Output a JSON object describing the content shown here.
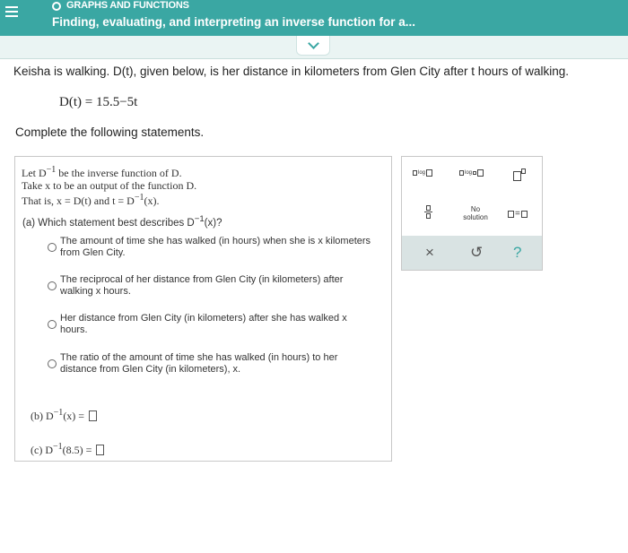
{
  "header": {
    "section_title": "GRAPHS AND FUNCTIONS",
    "problem_title": "Finding, evaluating, and interpreting an inverse function for a..."
  },
  "intro": "Keisha is walking. D(t), given below, is her distance in kilometers from Glen City after t hours of walking.",
  "formula": "D(t) = 15.5−5t",
  "instruction": "Complete the following statements.",
  "definition": {
    "line1_pre": "Let D",
    "line1_sup": "−1",
    "line1_post": " be the inverse function of D.",
    "line2": "Take x to be an output of the function D.",
    "line3_pre": "That is, x = D(t) and t = D",
    "line3_sup": "−1",
    "line3_post": "(x)."
  },
  "part_a": {
    "prompt_pre": "(a)  Which statement best describes D",
    "prompt_sup": "−1",
    "prompt_post": "(x)?",
    "options": [
      "The amount of time she has walked (in hours) when she is x kilometers from Glen City.",
      "The reciprocal of her distance from Glen City (in kilometers) after walking x hours.",
      "Her distance from Glen City (in kilometers) after she has walked x hours.",
      "The ratio of the amount of time she has walked (in hours) to her distance from Glen City (in kilometers), x."
    ]
  },
  "part_b": {
    "label": "(b)  D",
    "sup": "−1",
    "post": "(x) = "
  },
  "part_c": {
    "label": "(c)  D",
    "sup": "−1",
    "post": "(8.5) = "
  },
  "palette": {
    "log_label": "log",
    "no_solution": "No solution",
    "equals": "=",
    "clear": "×",
    "undo": "↺",
    "help": "?"
  }
}
